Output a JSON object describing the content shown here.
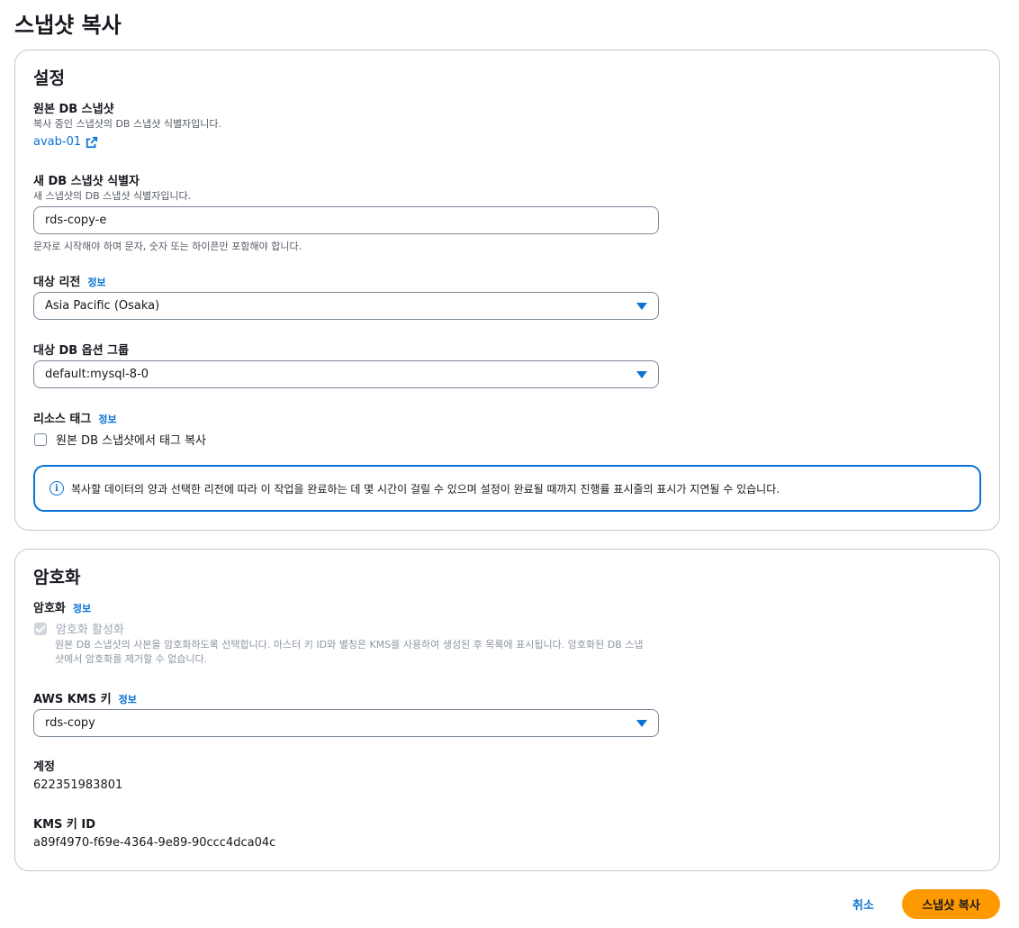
{
  "page": {
    "title": "스냅샷 복사"
  },
  "settings": {
    "title": "설정",
    "source": {
      "label": "원본 DB 스냅샷",
      "desc": "복사 중인 스냅샷의 DB 스냅샷 식별자입니다.",
      "link": "avab-01"
    },
    "new_identifier": {
      "label": "새 DB 스냅샷 식별자",
      "desc": "새 스냅샷의 DB 스냅샷 식별자입니다.",
      "value": "rds-copy-e",
      "hint": "문자로 시작해야 하며 문자, 숫자 또는 하이픈만 포함해야 합니다."
    },
    "region": {
      "label": "대상 리전",
      "info": "정보",
      "value": "Asia Pacific (Osaka)"
    },
    "option_group": {
      "label": "대상 DB 옵션 그룹",
      "value": "default:mysql-8-0"
    },
    "tags": {
      "label": "리소스 태그",
      "info": "정보",
      "checkbox_label": "원본 DB 스냅샷에서 태그 복사"
    },
    "alert": "복사할 데이터의 양과 선택한 리전에 따라 이 작업을 완료하는 데 몇 시간이 걸릴 수 있으며 설정이 완료될 때까지 진행률 표시줄의 표시가 지연될 수 있습니다."
  },
  "encryption": {
    "title": "암호화",
    "label": "암호화",
    "info": "정보",
    "checkbox_label": "암호화 활성화",
    "checkbox_desc_line1": "원본 DB 스냅샷의 사본을 암호화하도록 선택합니다. 마스터 키 ID와 별칭은 KMS를 사용하여 생성된 후 목록에 표시됩니다. 암호화된 DB 스냅",
    "checkbox_desc_line2": "샷에서 암호화를 제거할 수 없습니다.",
    "kms": {
      "label": "AWS KMS 키",
      "info": "정보",
      "value": "rds-copy"
    },
    "account": {
      "label": "계정",
      "value": "622351983801"
    },
    "kms_id": {
      "label": "KMS 키 ID",
      "value": "a89f4970-f69e-4364-9e89-90ccc4dca04c"
    }
  },
  "footer": {
    "cancel": "취소",
    "submit": "스냅샷 복사"
  },
  "colors": {
    "accent": "#0972d3",
    "primary_button": "#ff9900",
    "border": "#c6c6cd"
  }
}
